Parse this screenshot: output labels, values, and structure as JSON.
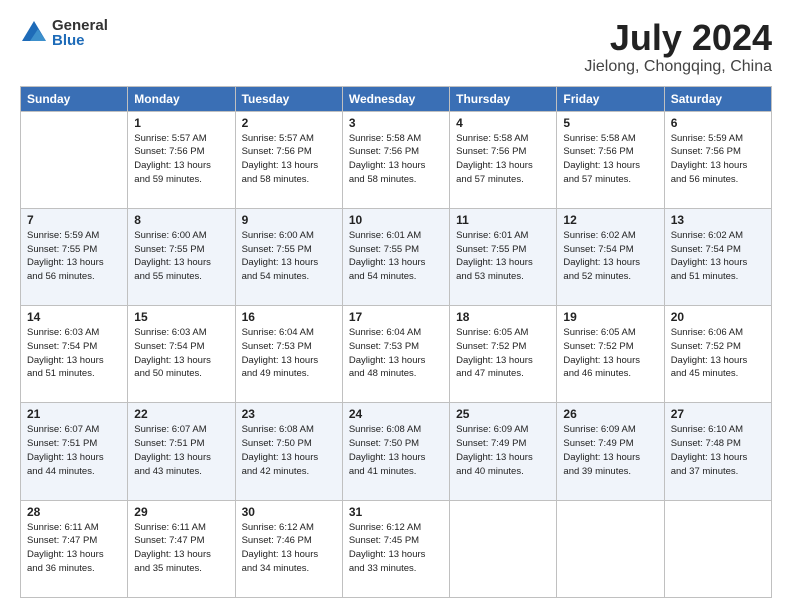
{
  "header": {
    "logo_general": "General",
    "logo_blue": "Blue",
    "month_title": "July 2024",
    "location": "Jielong, Chongqing, China"
  },
  "days_of_week": [
    "Sunday",
    "Monday",
    "Tuesday",
    "Wednesday",
    "Thursday",
    "Friday",
    "Saturday"
  ],
  "weeks": [
    [
      {
        "day": "",
        "info": ""
      },
      {
        "day": "1",
        "info": "Sunrise: 5:57 AM\nSunset: 7:56 PM\nDaylight: 13 hours\nand 59 minutes."
      },
      {
        "day": "2",
        "info": "Sunrise: 5:57 AM\nSunset: 7:56 PM\nDaylight: 13 hours\nand 58 minutes."
      },
      {
        "day": "3",
        "info": "Sunrise: 5:58 AM\nSunset: 7:56 PM\nDaylight: 13 hours\nand 58 minutes."
      },
      {
        "day": "4",
        "info": "Sunrise: 5:58 AM\nSunset: 7:56 PM\nDaylight: 13 hours\nand 57 minutes."
      },
      {
        "day": "5",
        "info": "Sunrise: 5:58 AM\nSunset: 7:56 PM\nDaylight: 13 hours\nand 57 minutes."
      },
      {
        "day": "6",
        "info": "Sunrise: 5:59 AM\nSunset: 7:56 PM\nDaylight: 13 hours\nand 56 minutes."
      }
    ],
    [
      {
        "day": "7",
        "info": "Sunrise: 5:59 AM\nSunset: 7:55 PM\nDaylight: 13 hours\nand 56 minutes."
      },
      {
        "day": "8",
        "info": "Sunrise: 6:00 AM\nSunset: 7:55 PM\nDaylight: 13 hours\nand 55 minutes."
      },
      {
        "day": "9",
        "info": "Sunrise: 6:00 AM\nSunset: 7:55 PM\nDaylight: 13 hours\nand 54 minutes."
      },
      {
        "day": "10",
        "info": "Sunrise: 6:01 AM\nSunset: 7:55 PM\nDaylight: 13 hours\nand 54 minutes."
      },
      {
        "day": "11",
        "info": "Sunrise: 6:01 AM\nSunset: 7:55 PM\nDaylight: 13 hours\nand 53 minutes."
      },
      {
        "day": "12",
        "info": "Sunrise: 6:02 AM\nSunset: 7:54 PM\nDaylight: 13 hours\nand 52 minutes."
      },
      {
        "day": "13",
        "info": "Sunrise: 6:02 AM\nSunset: 7:54 PM\nDaylight: 13 hours\nand 51 minutes."
      }
    ],
    [
      {
        "day": "14",
        "info": "Sunrise: 6:03 AM\nSunset: 7:54 PM\nDaylight: 13 hours\nand 51 minutes."
      },
      {
        "day": "15",
        "info": "Sunrise: 6:03 AM\nSunset: 7:54 PM\nDaylight: 13 hours\nand 50 minutes."
      },
      {
        "day": "16",
        "info": "Sunrise: 6:04 AM\nSunset: 7:53 PM\nDaylight: 13 hours\nand 49 minutes."
      },
      {
        "day": "17",
        "info": "Sunrise: 6:04 AM\nSunset: 7:53 PM\nDaylight: 13 hours\nand 48 minutes."
      },
      {
        "day": "18",
        "info": "Sunrise: 6:05 AM\nSunset: 7:52 PM\nDaylight: 13 hours\nand 47 minutes."
      },
      {
        "day": "19",
        "info": "Sunrise: 6:05 AM\nSunset: 7:52 PM\nDaylight: 13 hours\nand 46 minutes."
      },
      {
        "day": "20",
        "info": "Sunrise: 6:06 AM\nSunset: 7:52 PM\nDaylight: 13 hours\nand 45 minutes."
      }
    ],
    [
      {
        "day": "21",
        "info": "Sunrise: 6:07 AM\nSunset: 7:51 PM\nDaylight: 13 hours\nand 44 minutes."
      },
      {
        "day": "22",
        "info": "Sunrise: 6:07 AM\nSunset: 7:51 PM\nDaylight: 13 hours\nand 43 minutes."
      },
      {
        "day": "23",
        "info": "Sunrise: 6:08 AM\nSunset: 7:50 PM\nDaylight: 13 hours\nand 42 minutes."
      },
      {
        "day": "24",
        "info": "Sunrise: 6:08 AM\nSunset: 7:50 PM\nDaylight: 13 hours\nand 41 minutes."
      },
      {
        "day": "25",
        "info": "Sunrise: 6:09 AM\nSunset: 7:49 PM\nDaylight: 13 hours\nand 40 minutes."
      },
      {
        "day": "26",
        "info": "Sunrise: 6:09 AM\nSunset: 7:49 PM\nDaylight: 13 hours\nand 39 minutes."
      },
      {
        "day": "27",
        "info": "Sunrise: 6:10 AM\nSunset: 7:48 PM\nDaylight: 13 hours\nand 37 minutes."
      }
    ],
    [
      {
        "day": "28",
        "info": "Sunrise: 6:11 AM\nSunset: 7:47 PM\nDaylight: 13 hours\nand 36 minutes."
      },
      {
        "day": "29",
        "info": "Sunrise: 6:11 AM\nSunset: 7:47 PM\nDaylight: 13 hours\nand 35 minutes."
      },
      {
        "day": "30",
        "info": "Sunrise: 6:12 AM\nSunset: 7:46 PM\nDaylight: 13 hours\nand 34 minutes."
      },
      {
        "day": "31",
        "info": "Sunrise: 6:12 AM\nSunset: 7:45 PM\nDaylight: 13 hours\nand 33 minutes."
      },
      {
        "day": "",
        "info": ""
      },
      {
        "day": "",
        "info": ""
      },
      {
        "day": "",
        "info": ""
      }
    ]
  ]
}
